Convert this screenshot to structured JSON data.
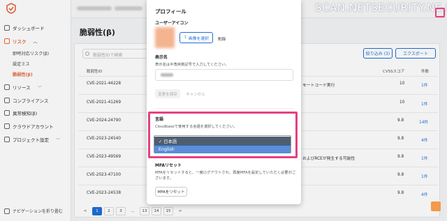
{
  "sidebar": {
    "items": [
      {
        "label": "ダッシュボード"
      },
      {
        "label": "リスク",
        "active": true
      },
      {
        "label": "リソース"
      },
      {
        "label": "コンプライアンス"
      },
      {
        "label": "異常検知(β)"
      },
      {
        "label": "クラウドアカウント"
      },
      {
        "label": "プロジェクト設定"
      }
    ],
    "sub_items": [
      {
        "label": "即時対応リスク(β)"
      },
      {
        "label": "設定ミス"
      },
      {
        "label": "脆弱性(β)",
        "active": true
      }
    ],
    "collapse_label": "ナビゲーションを折り畳む"
  },
  "topbar": {
    "crumb_tail": "日本 | ..."
  },
  "main": {
    "title": "脆弱性(β)",
    "search_placeholder": "脆弱性IDで検索",
    "filter_label": "絞り込み (3)",
    "export_label": "エクスポート",
    "columns": {
      "id": "脆弱性ID",
      "cvss": "CVSSスコア",
      "count": "件数"
    },
    "rows": [
      {
        "id": "CVE-2021-44228",
        "desc": "モートコード実行",
        "cvss": "10",
        "count": "1件"
      },
      {
        "id": "CVE-2021-41269",
        "desc": "",
        "cvss": "10",
        "count": "1件"
      },
      {
        "id": "CVE-2024-24790",
        "desc": "",
        "cvss": "9.8",
        "count": "14件"
      },
      {
        "id": "CVE-2023-24540",
        "desc": "",
        "cvss": "9.8",
        "count": "4件"
      },
      {
        "id": "CVE-2023-49569",
        "desc": "およびRCEが発生する可能性",
        "cvss": "9.8",
        "count": "1件"
      },
      {
        "id": "CVE-2023-47100",
        "desc": "",
        "cvss": "9.8",
        "count": "1件"
      },
      {
        "id": "CVE-2023-24538",
        "desc": "",
        "cvss": "9.8",
        "count": "4件"
      }
    ],
    "pagination": [
      "<",
      "1",
      "2",
      "3",
      "...",
      "13",
      "14",
      "15",
      ">"
    ]
  },
  "modal": {
    "title": "プロフィール",
    "avatar_label": "ユーザーアイコン",
    "select_image_label": "画像を選択",
    "delete_label": "削除",
    "display_name_label": "表示名",
    "display_name_help": "表示名は半角英数記号で入力してください。",
    "save_label": "変更を保存",
    "cancel_label": "キャンセル",
    "language_label": "言語",
    "language_help": "Cloudbaseで使用する言語を選択してください。",
    "language_options": [
      "✓ 日本語",
      "English"
    ],
    "mfa_label": "MFAリセット",
    "mfa_help_1": "MFAをリセットすると、一度ログアウトされ、再度MFAを設定していただく必要がご",
    "mfa_help_2": "ざいます。",
    "mfa_reset_label": "MFAをリセット"
  },
  "watermark": "SCAN.NETSECURITY.NE.JP",
  "colors": {
    "accent": "#e8663d",
    "primary": "#1e6fd9",
    "highlight": "#e64080"
  }
}
